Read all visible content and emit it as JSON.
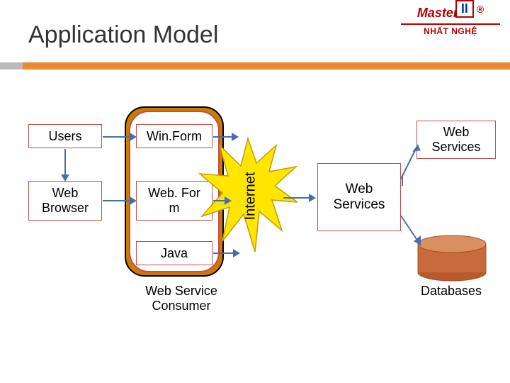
{
  "title": "Application Model",
  "logo": {
    "word": "Master",
    "mark": "II",
    "reg": "®",
    "sub": "NHẤT NGHỆ"
  },
  "left": {
    "users": "Users",
    "browser": "Web\nBrowser"
  },
  "mid": {
    "winform": "Win.Form",
    "webform": "Web. For\nm",
    "java": "Java",
    "consumer": "Web Service\nConsumer"
  },
  "internet": "Internet",
  "right": {
    "ws1_top": "Web\nServices",
    "ws2": "Web\nServices",
    "db": "Databases"
  },
  "colors": {
    "rule": "#e88b2a",
    "boxBorder": "#c0504d",
    "arrow": "#476fb0",
    "star": "#ffeb3b",
    "dbTop": "#d48a5a",
    "dbBody": "#c76b3d"
  }
}
